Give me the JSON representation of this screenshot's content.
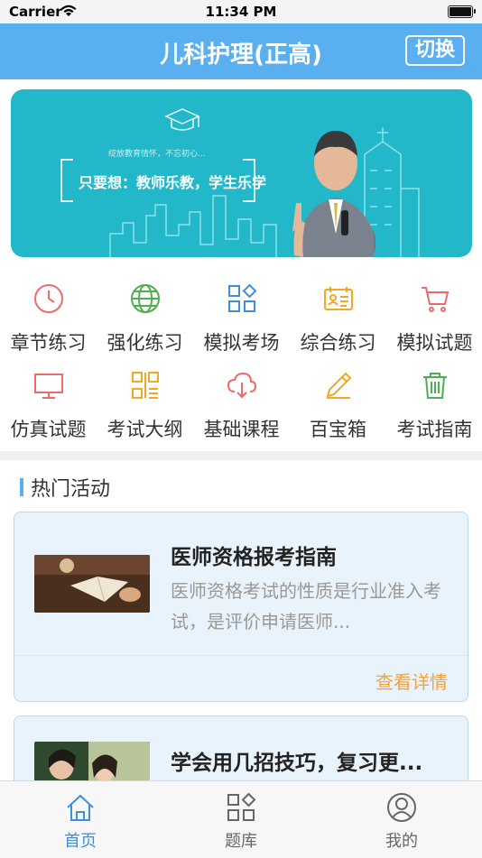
{
  "status_bar": {
    "carrier": "Carrier",
    "time": "11:34 PM"
  },
  "header": {
    "title": "儿科护理(正高)",
    "switch_label": "切换"
  },
  "banner": {
    "motto_small": "绽放教育情怀，不忘初心...",
    "motto": "只要想：教师乐教，学生乐学"
  },
  "menu": {
    "items": [
      {
        "label": "章节练习",
        "icon": "clock-icon",
        "color": "#f06a6a"
      },
      {
        "label": "强化练习",
        "icon": "globe-icon",
        "color": "#4caf50"
      },
      {
        "label": "模拟考场",
        "icon": "grid-icon",
        "color": "#3d8fe0"
      },
      {
        "label": "综合练习",
        "icon": "id-card-icon",
        "color": "#f5a623"
      },
      {
        "label": "模拟试题",
        "icon": "cart-icon",
        "color": "#f06a6a"
      },
      {
        "label": "仿真试题",
        "icon": "monitor-icon",
        "color": "#f06a6a"
      },
      {
        "label": "考试大纲",
        "icon": "qr-code-icon",
        "color": "#f5a623"
      },
      {
        "label": "基础课程",
        "icon": "cloud-download-icon",
        "color": "#f06a6a"
      },
      {
        "label": "百宝箱",
        "icon": "pencil-icon",
        "color": "#f5a623"
      },
      {
        "label": "考试指南",
        "icon": "trash-icon",
        "color": "#4caf50"
      }
    ]
  },
  "activities": {
    "section_title": "热门活动",
    "cards": [
      {
        "title": "医师资格报考指南",
        "description": "医师资格考试的性质是行业准入考试，是评价申请医师...",
        "more_label": "查看详情"
      },
      {
        "title": "学会用几招技巧，复习更..."
      }
    ]
  },
  "tabbar": {
    "tabs": [
      {
        "label": "首页",
        "icon": "home-icon",
        "active": true
      },
      {
        "label": "题库",
        "icon": "grid-icon",
        "active": false
      },
      {
        "label": "我的",
        "icon": "user-icon",
        "active": false
      }
    ],
    "active_color": "#3d8fe0",
    "inactive_color": "#666666"
  }
}
